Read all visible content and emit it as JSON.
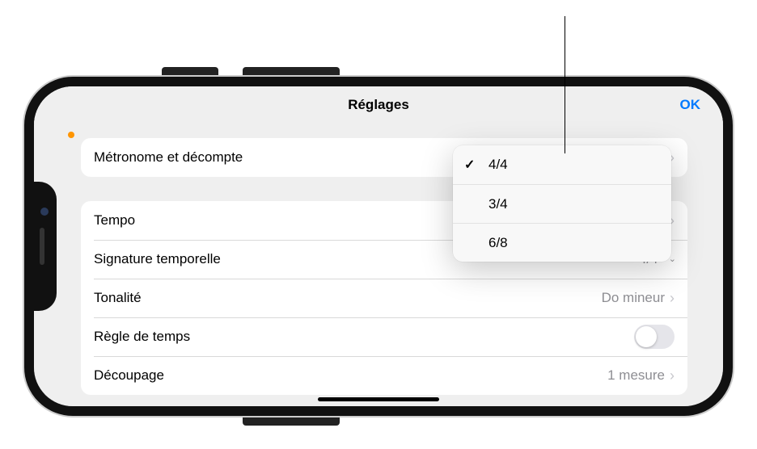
{
  "nav": {
    "title": "Réglages",
    "ok": "OK"
  },
  "group1": {
    "metronome": {
      "label": "Métronome et décompte"
    }
  },
  "group2": {
    "tempo": {
      "label": "Tempo"
    },
    "timesig": {
      "label": "Signature temporelle",
      "value": "4/4"
    },
    "key": {
      "label": "Tonalité",
      "value": "Do mineur"
    },
    "ruler": {
      "label": "Règle de temps"
    },
    "snap": {
      "label": "Découpage",
      "value": "1 mesure"
    }
  },
  "timesig_menu": {
    "options": [
      "4/4",
      "3/4",
      "6/8"
    ],
    "selected": "4/4"
  }
}
